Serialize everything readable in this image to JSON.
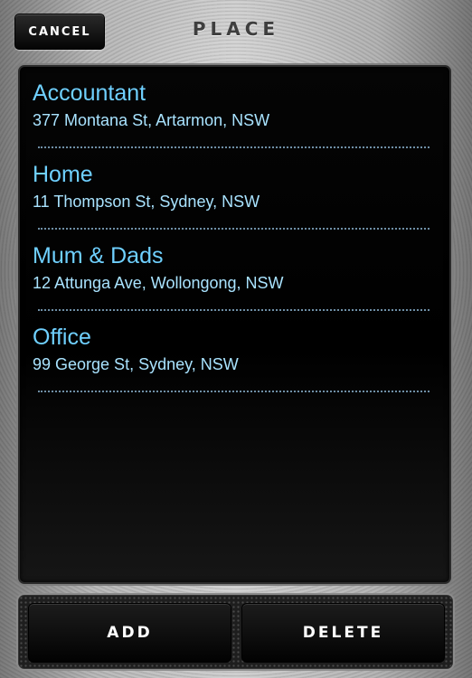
{
  "header": {
    "cancel_label": "CANCEL",
    "title": "PLACE"
  },
  "places": [
    {
      "name": "Accountant",
      "address": "377 Montana St, Artarmon, NSW"
    },
    {
      "name": "Home",
      "address": "11 Thompson St, Sydney, NSW"
    },
    {
      "name": "Mum & Dads",
      "address": "12 Attunga Ave, Wollongong, NSW"
    },
    {
      "name": "Office",
      "address": "99 George St, Sydney, NSW"
    }
  ],
  "toolbar": {
    "add_label": "ADD",
    "delete_label": "DELETE"
  },
  "colors": {
    "name_text": "#6fd0ff",
    "address_text": "#a9e3ff",
    "panel_bg": "#000000"
  }
}
